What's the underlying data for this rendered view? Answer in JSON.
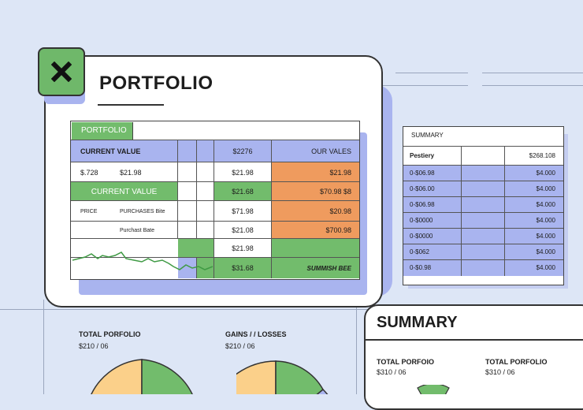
{
  "window": {
    "title": "PORTFOLIO"
  },
  "sheet": {
    "tab_label": "PORTFOLIO",
    "rows": [
      {
        "a": "CURRENT VALUE",
        "d": "$2276",
        "f": "OUR VALES"
      },
      {
        "a1": "$.728",
        "a2": "$21.98",
        "d": "$21.98",
        "f": "$21.98"
      },
      {
        "a": "CURRENT VALUE",
        "d": "$21.68",
        "f": "$70.98 $8"
      },
      {
        "a1": "PRICE",
        "a2": "PURCHASES Bite",
        "d": "$71.98",
        "f": "$20.98"
      },
      {
        "a2": "Purchast Bate",
        "d": "$21.08",
        "f": "$700.98"
      },
      {
        "d": "$21.98"
      },
      {
        "d": "$31.68",
        "f": "SUMMISH BEE"
      }
    ]
  },
  "summary_table": {
    "header": "SUMMARY",
    "first_row": {
      "label": "Pestiery",
      "value": "$268.108"
    },
    "rows": [
      {
        "label": "0-$06.98",
        "value": "$4.000"
      },
      {
        "label": "0-$06.00",
        "value": "$4.000"
      },
      {
        "label": "0-$06.98",
        "value": "$4.000"
      },
      {
        "label": "0-$0000",
        "value": "$4.000"
      },
      {
        "label": "0-$0000",
        "value": "$4.000"
      },
      {
        "label": "0-$062",
        "value": "$4.000"
      },
      {
        "label": "0-$0.98",
        "value": "$4.000"
      }
    ]
  },
  "bottom": {
    "total_label": "TOTAL PORFOLIO",
    "total_value": "$210 / 06",
    "gains_label": "GAINS / / LOSSES",
    "gains_value": "$210 / 06"
  },
  "summary_card": {
    "title": "SUMMARY",
    "left_label": "TOTAL PORFOIO",
    "left_value": "$310 / 06",
    "right_label": "TOTAL PORFOLIO",
    "right_value": "$310 / 06"
  },
  "colors": {
    "background": "#dde6f6",
    "accent_blue": "#a9b4ef",
    "accent_green": "#72bc6c",
    "accent_orange": "#ef9b5e",
    "pie_yellow": "#fbd08a"
  },
  "icons": {
    "app_icon": "excel-close-icon"
  }
}
